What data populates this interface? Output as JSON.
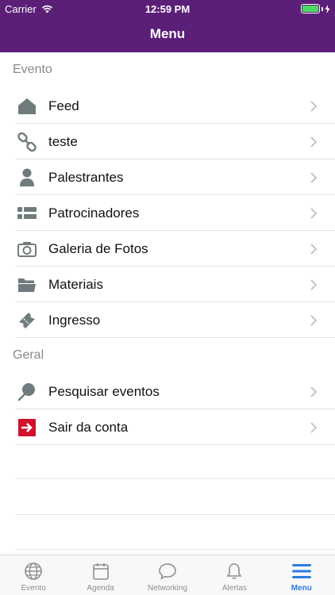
{
  "status_bar": {
    "carrier": "Carrier",
    "time": "12:59 PM"
  },
  "nav": {
    "title": "Menu"
  },
  "sections": [
    {
      "title": "Evento",
      "items": [
        {
          "label": "Feed",
          "icon": "home-icon"
        },
        {
          "label": "teste",
          "icon": "link-icon"
        },
        {
          "label": "Palestrantes",
          "icon": "person-icon"
        },
        {
          "label": "Patrocinadores",
          "icon": "list-icon"
        },
        {
          "label": "Galeria de Fotos",
          "icon": "camera-icon"
        },
        {
          "label": "Materiais",
          "icon": "folder-icon"
        },
        {
          "label": "Ingresso",
          "icon": "ticket-icon"
        }
      ]
    },
    {
      "title": "Geral",
      "items": [
        {
          "label": "Pesquisar eventos",
          "icon": "search-pin-icon"
        },
        {
          "label": "Sair da conta",
          "icon": "logout-icon"
        }
      ]
    }
  ],
  "tabbar": {
    "tabs": [
      {
        "label": "Evento",
        "icon": "globe-icon",
        "active": false
      },
      {
        "label": "Agenda",
        "icon": "calendar-icon",
        "active": false
      },
      {
        "label": "Networking",
        "icon": "chat-bubble-icon",
        "active": false
      },
      {
        "label": "Alertas",
        "icon": "bell-icon",
        "active": false
      },
      {
        "label": "Menu",
        "icon": "hamburger-icon",
        "active": true
      }
    ]
  },
  "colors": {
    "header_bg": "#5b1f78",
    "icon_gray": "#6f7b7c",
    "logout_red": "#d0112b",
    "tab_active": "#2a7de1",
    "tab_inactive": "#8e8e93"
  }
}
